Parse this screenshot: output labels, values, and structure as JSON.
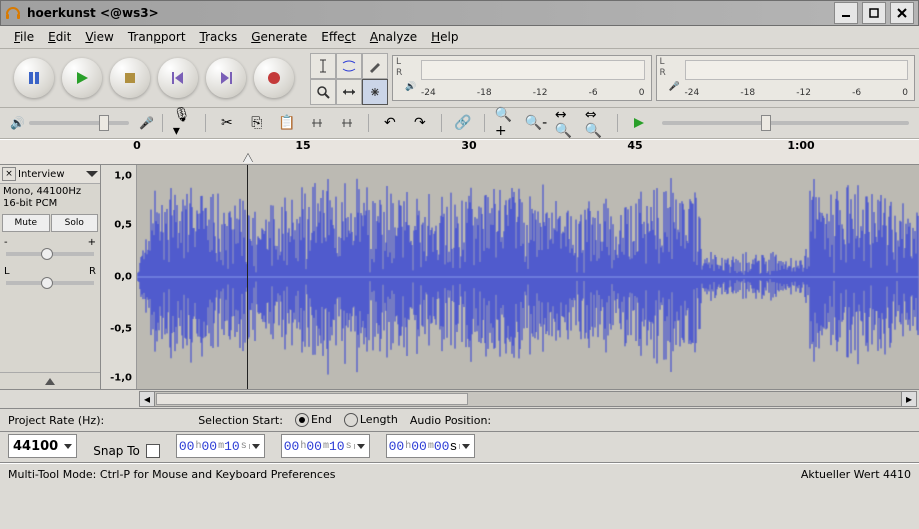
{
  "window": {
    "title": "hoerkunst <@ws3>"
  },
  "menu": {
    "file": "File",
    "edit": "Edit",
    "view": "View",
    "transport": "Transport",
    "tracks": "Tracks",
    "generate": "Generate",
    "effect": "Effect",
    "analyze": "Analyze",
    "help": "Help"
  },
  "meters": {
    "left": "L",
    "right": "R",
    "ticks": [
      "-24",
      "-18",
      "-12",
      "-6",
      "0"
    ]
  },
  "ruler": {
    "labels": [
      "0",
      "15",
      "30",
      "45",
      "1:00"
    ]
  },
  "track": {
    "name": "Interview",
    "format_line1": "Mono, 44100Hz",
    "format_line2": "16-bit PCM",
    "mute": "Mute",
    "solo": "Solo",
    "gain_minus": "-",
    "gain_plus": "+",
    "pan_l": "L",
    "pan_r": "R",
    "vscale": [
      "1,0",
      "0,5",
      "0,0",
      "-0,5",
      "-1,0"
    ]
  },
  "selection": {
    "project_rate_label": "Project Rate (Hz):",
    "project_rate_value": "44100",
    "snap_to": "Snap To",
    "sel_start_label": "Selection Start:",
    "end_label": "End",
    "length_label": "Length",
    "audio_pos_label": "Audio Position:",
    "time_start": {
      "h": "00",
      "m": "00",
      "s": "10"
    },
    "time_end": {
      "h": "00",
      "m": "00",
      "s": "10"
    },
    "time_pos": {
      "h": "00",
      "m": "00",
      "s": "00"
    }
  },
  "status": {
    "left": "Multi-Tool Mode: Ctrl-P for Mouse and Keyboard Preferences",
    "right": "Aktueller Wert 4410"
  }
}
